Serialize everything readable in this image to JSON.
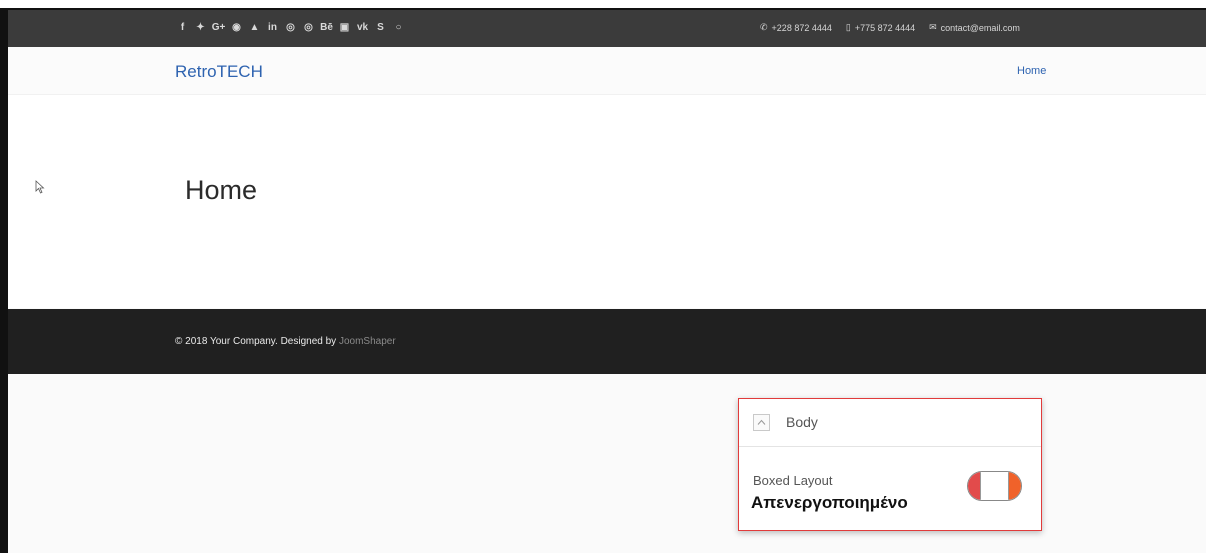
{
  "topbar": {
    "social_icons": [
      "f",
      "✦",
      "G+",
      "◉",
      "▲",
      "in",
      "◎",
      "◎",
      "Bē",
      "▣",
      "vk",
      "S",
      "○"
    ],
    "phone": "+228 872 4444",
    "mobile": "+775 872 4444",
    "email": "contact@email.com"
  },
  "navbar": {
    "logo": "RetroTECH",
    "menu_home": "Home"
  },
  "content": {
    "title": "Home"
  },
  "footer": {
    "copyright": "© 2018 Your Company. Designed by",
    "designer": "JoomShaper"
  },
  "panel": {
    "section_title": "Body",
    "setting_label": "Boxed Layout",
    "state_text": "Απενεργοποιημένο",
    "toggle_on": false
  },
  "colors": {
    "accent": "#2e63b0",
    "highlight": "#e13b3b",
    "toggle_left": "#e24b4b",
    "toggle_right": "#f0622a"
  }
}
